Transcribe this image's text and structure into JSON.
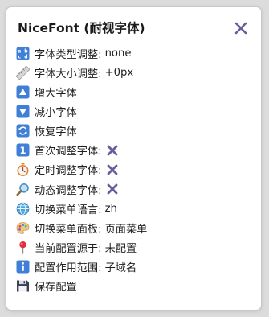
{
  "header": {
    "title": "NiceFont (耐视字体)",
    "close_icon": "close-x-icon",
    "close_color": "#6b5a9e"
  },
  "items": [
    {
      "icon": "abcd-icon",
      "label": "字体类型调整:",
      "value": "none"
    },
    {
      "icon": "ruler-icon",
      "label": "字体大小调整:",
      "value": "+0px"
    },
    {
      "icon": "up-triangle-icon",
      "label": "增大字体"
    },
    {
      "icon": "down-triangle-icon",
      "label": "减小字体"
    },
    {
      "icon": "counterclockwise-arrows-icon",
      "label": "恢复字体"
    },
    {
      "icon": "keycap-1-icon",
      "label": "首次调整字体:",
      "status_icon": "x-mark-icon"
    },
    {
      "icon": "stopwatch-icon",
      "label": "定时调整字体:",
      "status_icon": "x-mark-icon"
    },
    {
      "icon": "magnifier-icon",
      "label": "动态调整字体:",
      "status_icon": "x-mark-icon"
    },
    {
      "icon": "globe-icon",
      "label": "切换菜单语言:",
      "value": "zh"
    },
    {
      "icon": "palette-icon",
      "label": "切换菜单面板:",
      "value": "页面菜单"
    },
    {
      "icon": "pushpin-icon",
      "label": "当前配置源于:",
      "value": "未配置"
    },
    {
      "icon": "info-icon",
      "label": "配置作用范围:",
      "value": "子域名"
    },
    {
      "icon": "floppy-disk-icon",
      "label": "保存配置"
    }
  ],
  "colors": {
    "keycap_blue": "#3f7fd6",
    "x_mark": "#6b5a9e"
  }
}
